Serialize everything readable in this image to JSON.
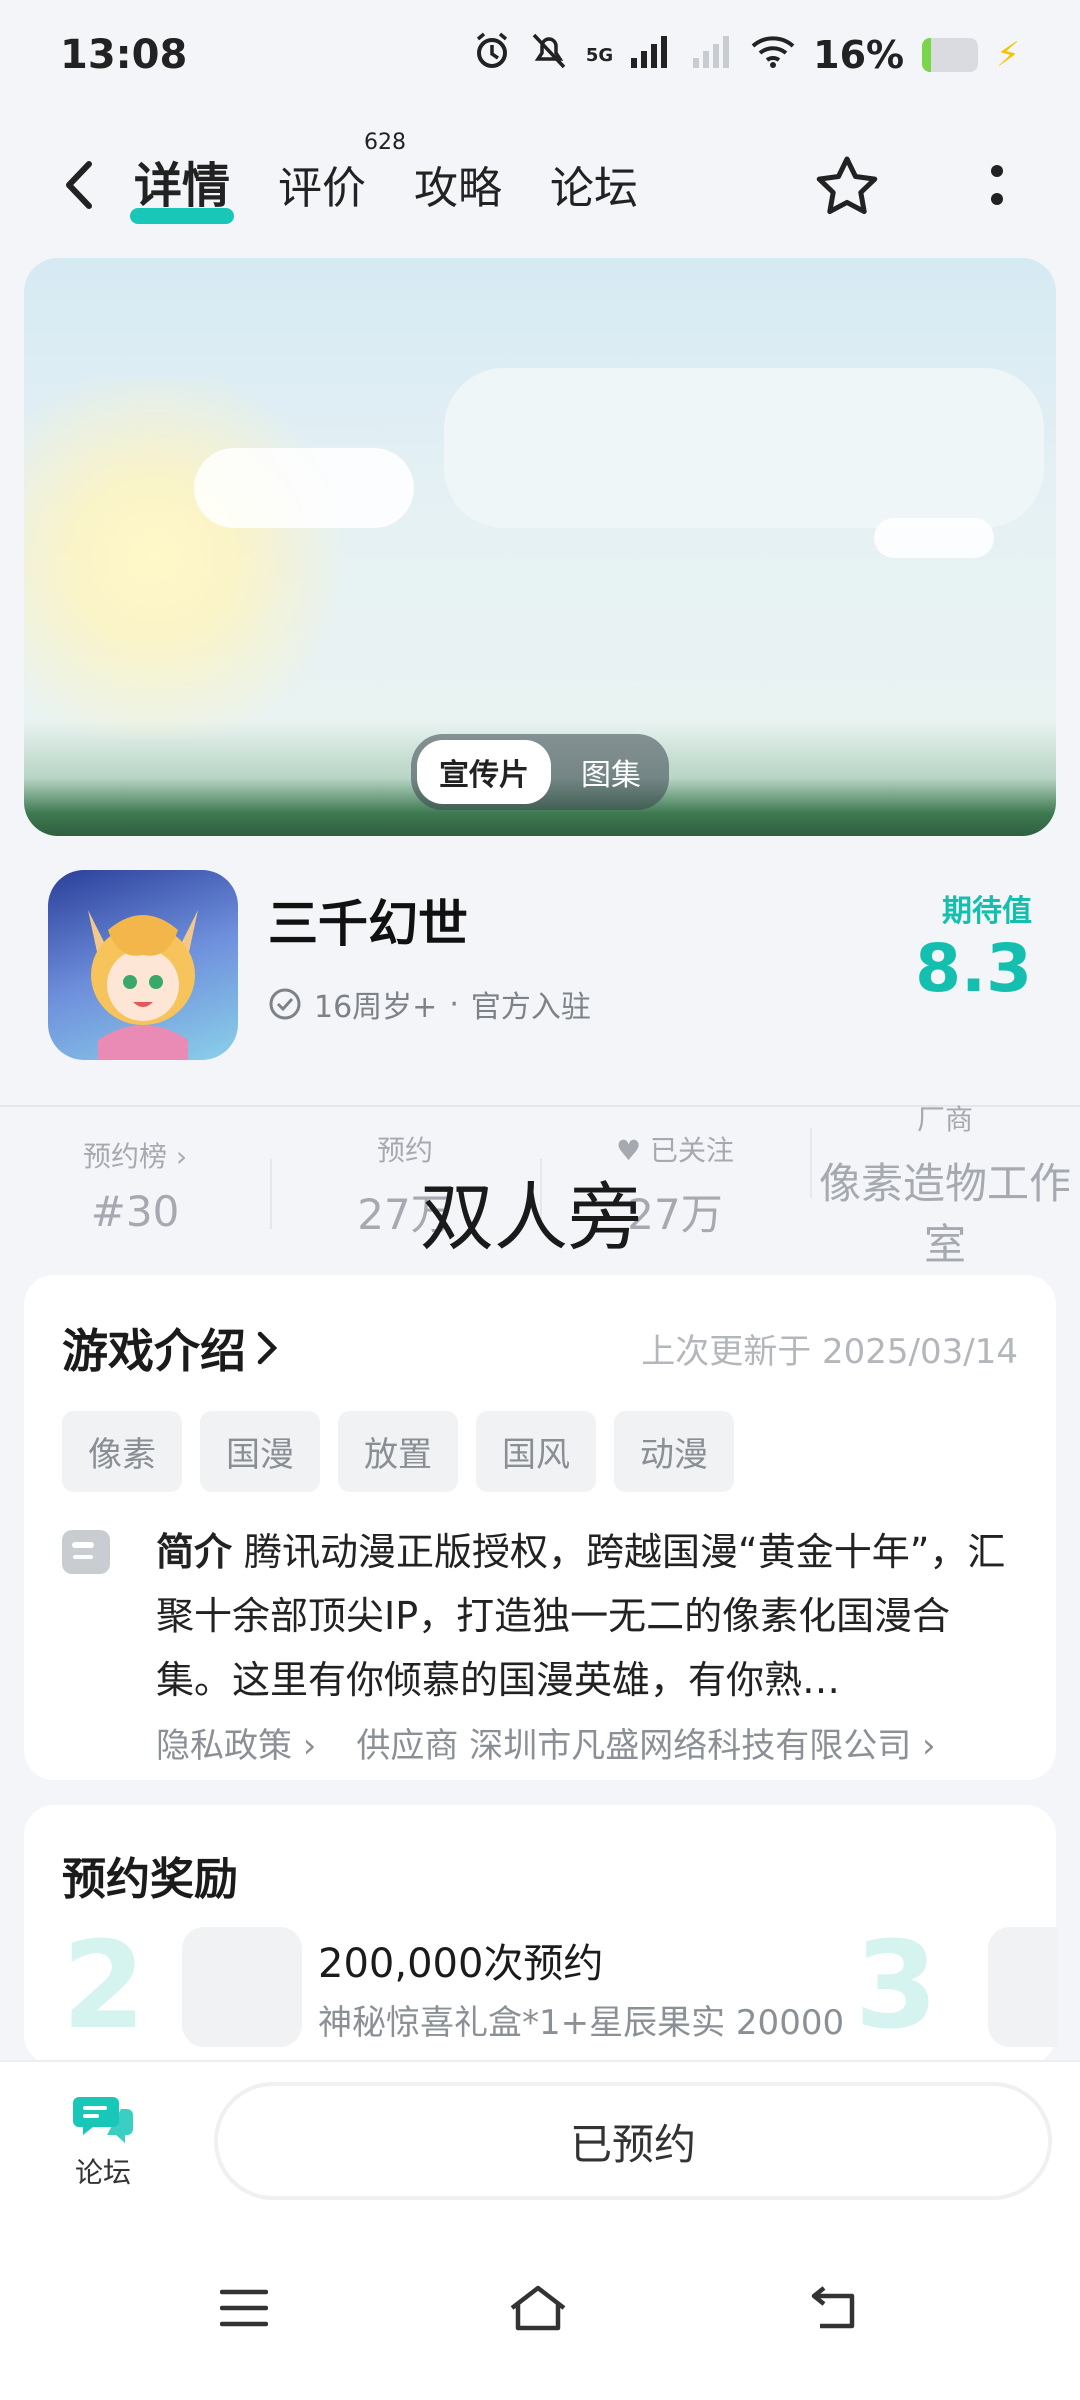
{
  "status_bar": {
    "time": "13:08",
    "network": "5G",
    "battery_text": "16%",
    "battery_level": 0.16,
    "icons": [
      "alarm-icon",
      "mute-icon",
      "signal-icon",
      "wifi-icon",
      "battery-icon",
      "charging-icon"
    ]
  },
  "nav": {
    "tabs": [
      {
        "label": "详情",
        "active": true
      },
      {
        "label": "评价",
        "badge": "628"
      },
      {
        "label": "攻略"
      },
      {
        "label": "论坛"
      }
    ]
  },
  "media": {
    "toggle": [
      "宣传片",
      "图集"
    ]
  },
  "game": {
    "title": "三千幻世",
    "age": "16周岁+",
    "separator": "·",
    "official": "官方入驻",
    "expect_label": "期待值",
    "expect_value": "8.3"
  },
  "stats": [
    {
      "label": "预约榜 ›",
      "value": "#30"
    },
    {
      "label": "预约",
      "value": "27万"
    },
    {
      "label": "♥ 已关注",
      "value": "27万"
    },
    {
      "label": "厂商",
      "value": "像素造物工作室"
    }
  ],
  "overlay_text": "双人旁",
  "intro": {
    "title": "游戏介绍",
    "updated": "上次更新于 2025/03/14",
    "tags": [
      "像素",
      "国漫",
      "放置",
      "国风",
      "动漫"
    ],
    "desc_prefix": "简介",
    "desc_text": "腾讯动漫正版授权，跨越国漫“黄金十年”，汇聚十余部顶尖IP，打造独一无二的像素化国漫合集。这里有你倾慕的国漫英雄，有你熟…",
    "privacy": "隐私政策 ›",
    "supplier": "供应商 深圳市凡盛网络科技有限公司 ›"
  },
  "reward": {
    "title": "预约奖励",
    "items": [
      {
        "num": "2",
        "name": "200,000次预约",
        "desc": "神秘惊喜礼盒*1+星辰果实 20000"
      },
      {
        "num": "3"
      }
    ]
  },
  "bottom": {
    "forum_label": "论坛",
    "reserved_label": "已预约"
  },
  "colors": {
    "accent": "#19c7b8",
    "background": "#f3f5f8"
  }
}
